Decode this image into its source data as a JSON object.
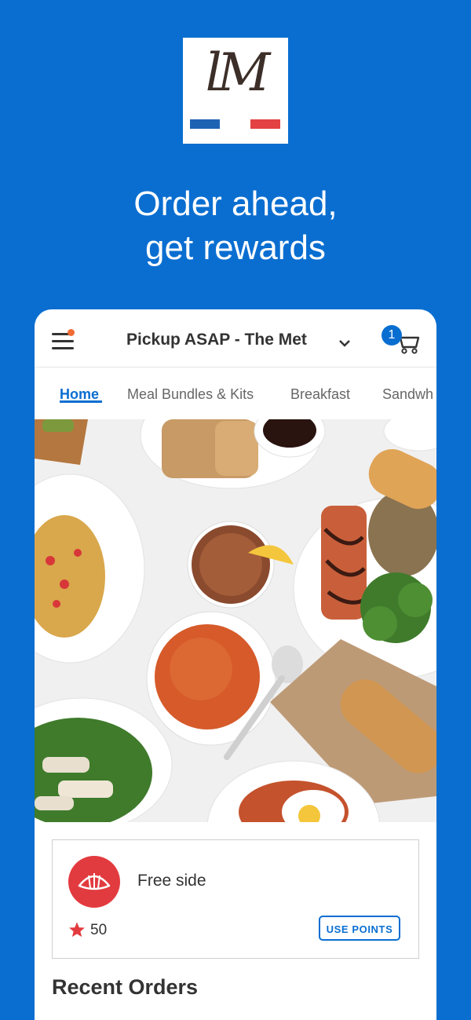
{
  "branding": {
    "logo_text": "lM",
    "colors": {
      "background": "#0a6ed1",
      "logo_blue": "#1d63b4",
      "logo_red": "#e34143"
    }
  },
  "headline": {
    "line1": "Order ahead,",
    "line2": "get rewards"
  },
  "app": {
    "header": {
      "pickup_label": "Pickup ASAP - The Met",
      "cart_count": "1",
      "icons": [
        "menu-icon",
        "chevron-down-icon",
        "cart-icon"
      ]
    },
    "tabs": [
      {
        "label": "Home",
        "active": true
      },
      {
        "label": "Meal Bundles & Kits"
      },
      {
        "label": "Breakfast"
      },
      {
        "label": "Sandwh"
      }
    ],
    "reward": {
      "title": "Free side",
      "points": "50",
      "button_label": "USE POINTS",
      "icons": [
        "croissant-icon",
        "star-icon"
      ]
    },
    "recent_orders_title": "Recent Orders"
  }
}
